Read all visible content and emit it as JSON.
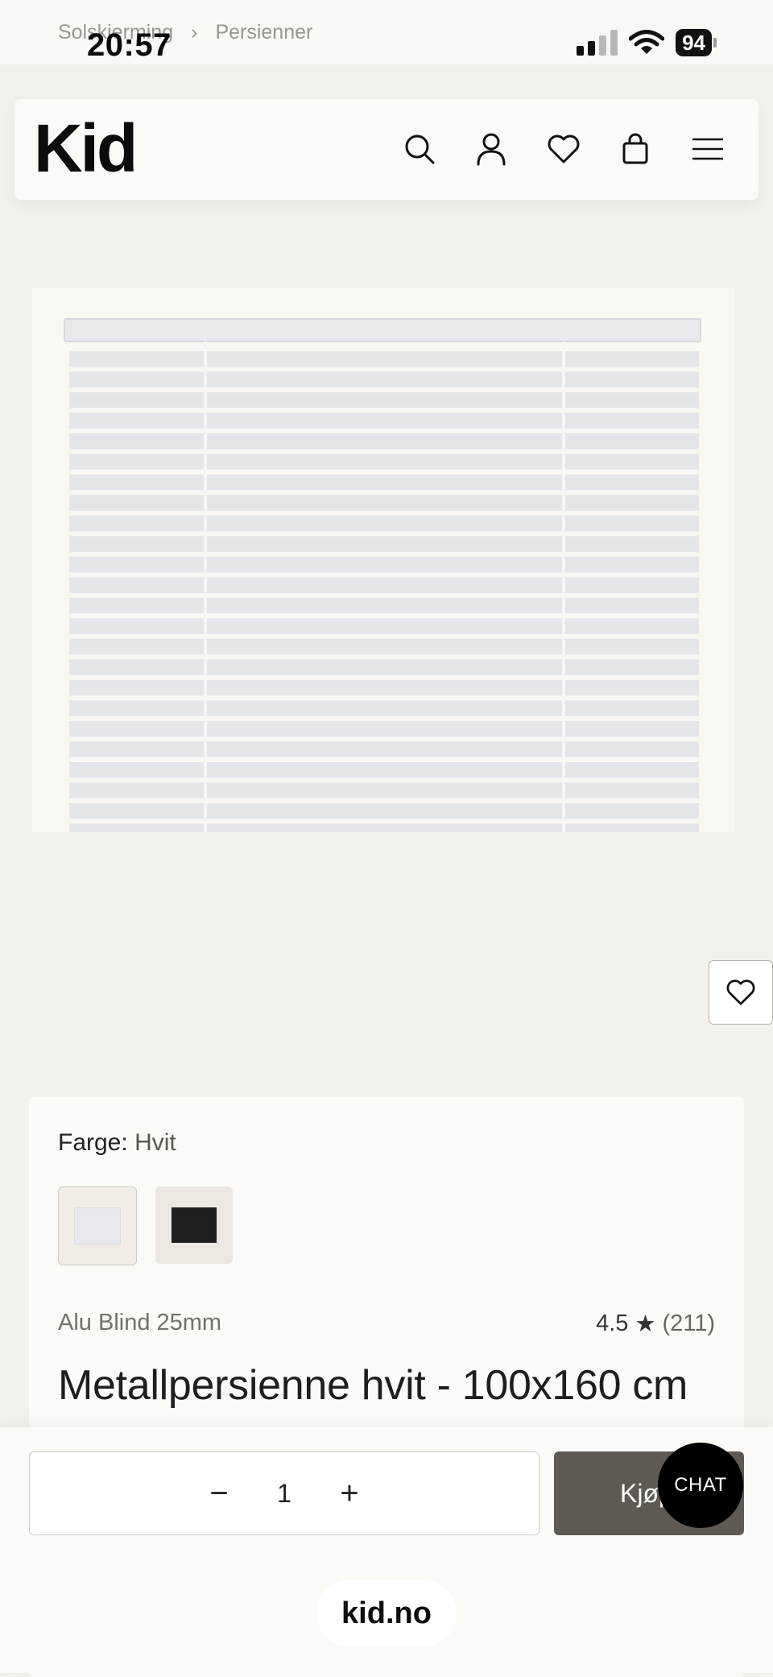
{
  "status_bar": {
    "time": "20:57",
    "battery": "94"
  },
  "breadcrumb": {
    "items": [
      "Solskjerming",
      "Persienner"
    ],
    "separator": "›"
  },
  "header": {
    "logo": "Kid"
  },
  "product": {
    "color_label": "Farge:",
    "color_value": "Hvit",
    "subtitle": "Alu Blind 25mm",
    "rating": "4.5",
    "rating_star": "★",
    "review_count": "(211)",
    "title": "Metallpersienne hvit - 100x160 cm"
  },
  "cart": {
    "minus": "−",
    "quantity": "1",
    "plus": "+",
    "buy_label": "Kjøp"
  },
  "chat": {
    "label": "CHAT"
  },
  "browser": {
    "url": "kid.no"
  },
  "colors": {
    "background": "#f4f1ec",
    "buy_button": "#5f5953",
    "chat_button": "#000000"
  }
}
